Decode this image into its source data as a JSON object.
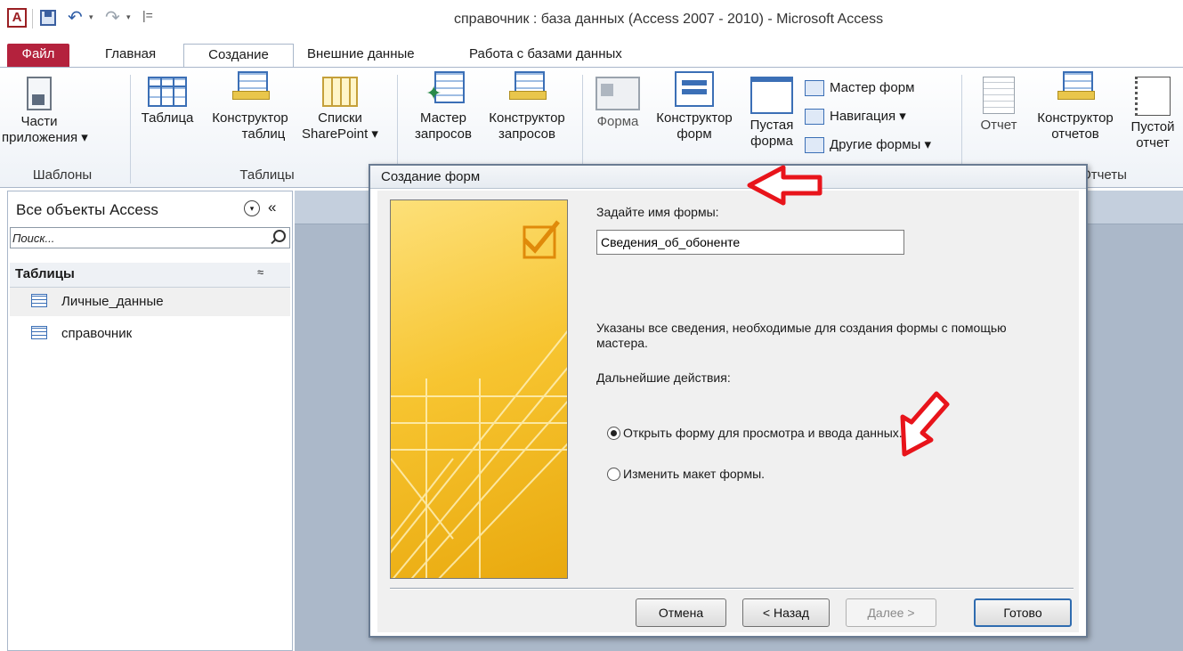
{
  "window": {
    "title": "справочник : база данных (Access 2007 - 2010)  -  Microsoft Access",
    "app_icon_letter": "A"
  },
  "tabs": [
    {
      "label": "Файл"
    },
    {
      "label": "Главная"
    },
    {
      "label": "Создание"
    },
    {
      "label": "Внешние данные"
    },
    {
      "label": "Работа с базами данных"
    }
  ],
  "ribbon": {
    "parts_line1": "Части",
    "parts_line2": "приложения ▾",
    "table": "Таблица",
    "table_design_line1": "Конструктор",
    "table_design_line2": "таблиц",
    "sharepoint_line1": "Списки",
    "sharepoint_line2": "SharePoint ▾",
    "query_wizard_line1": "Мастер",
    "query_wizard_line2": "запросов",
    "query_design_line1": "Конструктор",
    "query_design_line2": "запросов",
    "form": "Форма",
    "form_design_line1": "Конструктор",
    "form_design_line2": "форм",
    "blank_form_line1": "Пустая",
    "blank_form_line2": "форма",
    "form_wizard": "Мастер форм",
    "navigation": "Навигация ▾",
    "more_forms": "Другие формы ▾",
    "report": "Отчет",
    "report_design_line1": "Конструктор",
    "report_design_line2": "отчетов",
    "blank_report_line1": "Пустой",
    "blank_report_line2": "отчет",
    "group_templates": "Шаблоны",
    "group_tables": "Таблицы",
    "group_reports": "Отчеты"
  },
  "nav_pane": {
    "title": "Все объекты Access",
    "collapse_glyph": "«",
    "dropdown_glyph": "▾",
    "search_placeholder": "Поиск...",
    "group_label": "Таблицы",
    "group_chevron": "≈",
    "items": [
      {
        "label": "Личные_данные",
        "selected": true
      },
      {
        "label": "справочник",
        "selected": false
      }
    ]
  },
  "dialog": {
    "title": "Создание форм",
    "name_label": "Задайте имя формы:",
    "name_value": "Сведения_об_обоненте",
    "info_text": "Указаны все сведения, необходимые для создания формы с помощью мастера.",
    "next_label": "Дальнейшие действия:",
    "options": [
      {
        "label": "Открыть форму для просмотра и ввода данных.",
        "checked": true
      },
      {
        "label": "Изменить макет формы.",
        "checked": false
      }
    ],
    "buttons": {
      "cancel": "Отмена",
      "back": "< Назад",
      "next": "Далее >",
      "finish": "Готово"
    }
  },
  "colors": {
    "file_tab": "#b4223d",
    "workspace": "#abb8c9",
    "annotation_arrow": "#e8141b"
  },
  "icons": [
    "app-icon",
    "save-icon",
    "undo-icon",
    "redo-icon",
    "search-icon",
    "table-icon",
    "wizard-image",
    "red-arrow-annotation"
  ]
}
